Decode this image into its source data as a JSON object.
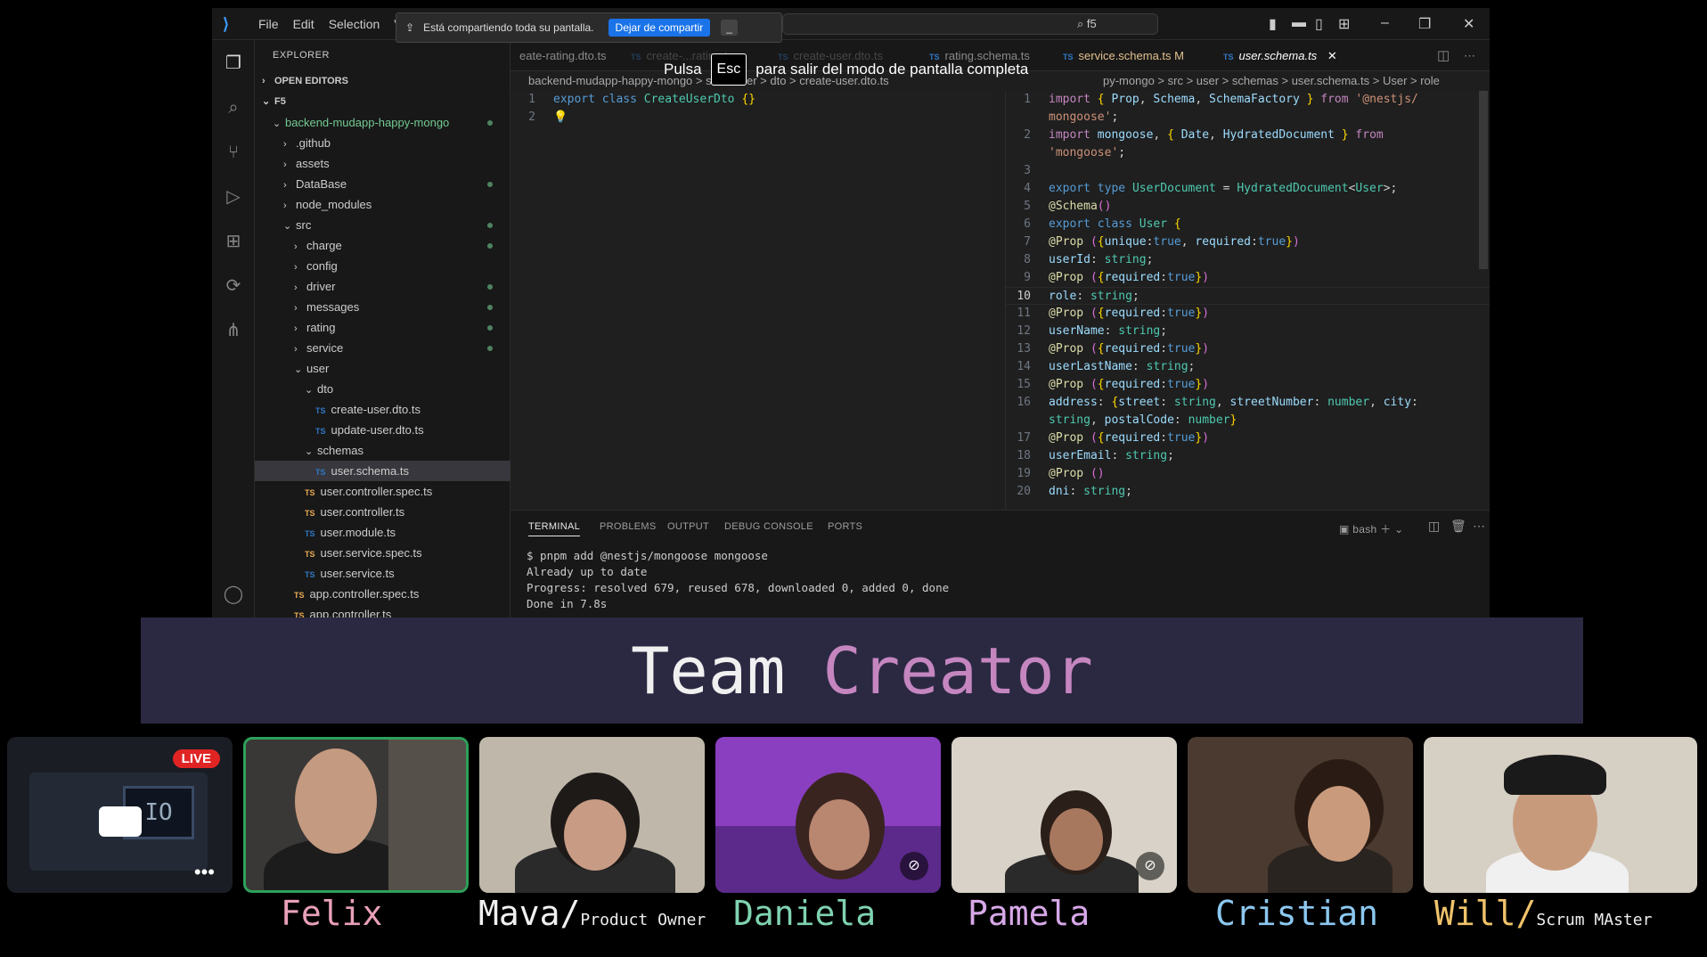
{
  "menu": [
    "File",
    "Edit",
    "Selection",
    "Vi"
  ],
  "search": "f5",
  "share_bar": {
    "text": "Está compartiendo toda su pantalla.",
    "stop": "Dejar de compartir"
  },
  "fullscreen_notice": {
    "pre": "Pulsa",
    "key": "Esc",
    "post": "para salir del modo de pantalla completa"
  },
  "sidebar": {
    "title": "EXPLORER",
    "open_editors": "OPEN EDITORS",
    "root": "F5",
    "tree": [
      {
        "label": "backend-mudapp-happy-mongo",
        "indent": 1,
        "chev": "v"
      },
      {
        "label": ".github",
        "indent": 2,
        "chev": ">"
      },
      {
        "label": "assets",
        "indent": 2,
        "chev": ">"
      },
      {
        "label": "DataBase",
        "indent": 2,
        "chev": ">"
      },
      {
        "label": "node_modules",
        "indent": 2,
        "chev": ">"
      },
      {
        "label": "src",
        "indent": 2,
        "chev": "v"
      },
      {
        "label": "charge",
        "indent": 3,
        "chev": ">"
      },
      {
        "label": "config",
        "indent": 3,
        "chev": ">"
      },
      {
        "label": "driver",
        "indent": 3,
        "chev": ">"
      },
      {
        "label": "messages",
        "indent": 3,
        "chev": ">"
      },
      {
        "label": "rating",
        "indent": 3,
        "chev": ">"
      },
      {
        "label": "service",
        "indent": 3,
        "chev": ">"
      },
      {
        "label": "user",
        "indent": 3,
        "chev": "v"
      },
      {
        "label": "dto",
        "indent": 4,
        "chev": "v"
      },
      {
        "label": "create-user.dto.ts",
        "indent": 5,
        "ts": "TS"
      },
      {
        "label": "update-user.dto.ts",
        "indent": 5,
        "ts": "TS"
      },
      {
        "label": "schemas",
        "indent": 4,
        "chev": "v"
      },
      {
        "label": "user.schema.ts",
        "indent": 5,
        "ts": "TS"
      },
      {
        "label": "user.controller.spec.ts",
        "indent": 4,
        "ts": "TS"
      },
      {
        "label": "user.controller.ts",
        "indent": 4,
        "ts": "TS"
      },
      {
        "label": "user.module.ts",
        "indent": 4,
        "ts": "TS"
      },
      {
        "label": "user.service.spec.ts",
        "indent": 4,
        "ts": "TS"
      },
      {
        "label": "user.service.ts",
        "indent": 4,
        "ts": "TS"
      },
      {
        "label": "app.controller.spec.ts",
        "indent": 3,
        "ts": "TS"
      },
      {
        "label": "app.controller.ts",
        "indent": 3,
        "ts": "TS"
      }
    ]
  },
  "tabs": [
    {
      "label": "eate-rating.dto.ts"
    },
    {
      "label": "create-...rating.ts"
    },
    {
      "label": "create-user.dto.ts"
    },
    {
      "label": "rating.schema.ts"
    },
    {
      "label": "service.schema.ts M"
    },
    {
      "label": "user.schema.ts"
    }
  ],
  "breadcrumb_left": "backend-mudapp-happy-mongo > src > user > dto > create-user.dto.ts",
  "breadcrumb_right": "py-mongo > src > user > schemas > user.schema.ts > User > role",
  "panel": {
    "tabs": [
      "TERMINAL",
      "PROBLEMS",
      "OUTPUT",
      "DEBUG CONSOLE",
      "PORTS"
    ],
    "shell": "bash",
    "lines": [
      "$ pnpm add @nestjs/mongoose mongoose",
      "Already up to date",
      "Progress: resolved 679, reused 678, downloaded 0, added 0, done",
      "Done in 7.8s"
    ]
  },
  "banner": {
    "word1": "Team",
    "word2": "Creator"
  },
  "participants": [
    {
      "name": "Felix",
      "role": "",
      "color": "#e9a0b8"
    },
    {
      "name": "Mava/",
      "role": "Product Owner",
      "color": "#f0f0f0"
    },
    {
      "name": "Daniela",
      "role": "",
      "color": "#7fd3b0"
    },
    {
      "name": "Pamela",
      "role": "",
      "color": "#d7a8e8"
    },
    {
      "name": "Cristian",
      "role": "",
      "color": "#8cc8f0"
    },
    {
      "name": "Will/",
      "role": "Scrum MAster",
      "color": "#f0c36a"
    }
  ],
  "live_badge": "LIVE"
}
